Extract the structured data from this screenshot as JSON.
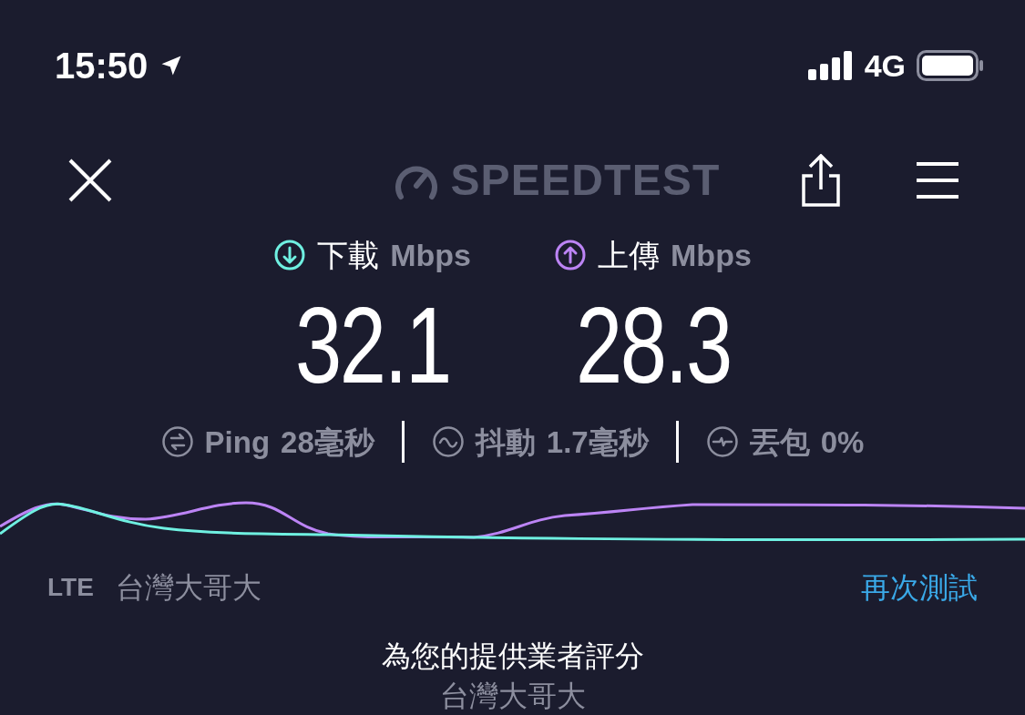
{
  "status_bar": {
    "time": "15:50",
    "network": "4G"
  },
  "header": {
    "logo_text": "SPEEDTEST"
  },
  "results": [
    {
      "kind": "download",
      "label": "下載",
      "unit": "Mbps",
      "value": "32.1",
      "color": "#6ff0e1"
    },
    {
      "kind": "upload",
      "label": "上傳",
      "unit": "Mbps",
      "value": "28.3",
      "color": "#bc84f5"
    }
  ],
  "metrics": [
    {
      "kind": "ping",
      "label": "Ping",
      "value": "28毫秒"
    },
    {
      "kind": "jitter",
      "label": "抖動",
      "value": "1.7毫秒"
    },
    {
      "kind": "loss",
      "label": "丟包",
      "value": "0%"
    }
  ],
  "connection": {
    "tech": "LTE",
    "carrier": "台灣大哥大"
  },
  "retest": "再次測試",
  "rating": {
    "title": "為您的提供業者評分",
    "provider": "台灣大哥大"
  }
}
